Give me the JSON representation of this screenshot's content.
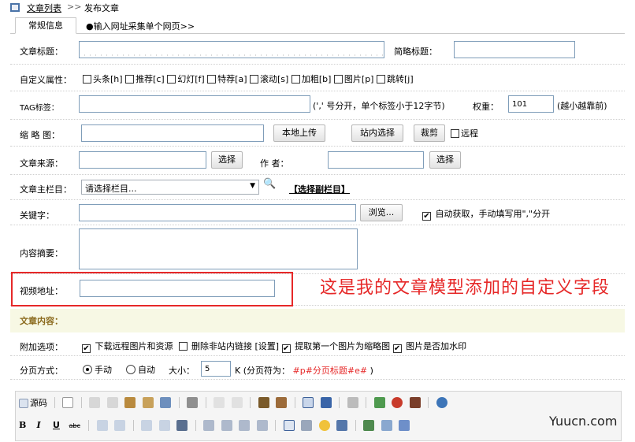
{
  "breadcrumb": {
    "list_link": "文章列表",
    "separator": ">>",
    "current": "发布文章"
  },
  "tabs": {
    "general": "常规信息",
    "url_collect": "●输入网址采集单个网页>>"
  },
  "form": {
    "title_label": "文章标题：",
    "short_title_label": "简略标题：",
    "custom_attr_label": "自定义属性：",
    "flags": [
      {
        "label": "头条[h]",
        "checked": false
      },
      {
        "label": "推荐[c]",
        "checked": false
      },
      {
        "label": "幻灯[f]",
        "checked": false
      },
      {
        "label": "特荐[a]",
        "checked": false
      },
      {
        "label": "滚动[s]",
        "checked": false
      },
      {
        "label": "加粗[b]",
        "checked": false
      },
      {
        "label": "图片[p]",
        "checked": false
      },
      {
        "label": "跳转[j]",
        "checked": false
      }
    ],
    "tag_label": "TAG标签：",
    "tag_hint": "(',' 号分开，单个标签小于12字节)",
    "weight_label": "权重：",
    "weight_value": "101",
    "weight_hint": "(越小越靠前)",
    "thumb_label": "缩 略 图：",
    "local_upload": "本地上传",
    "site_select": "站内选择",
    "crop": "裁剪",
    "remote_label": "远程",
    "source_label": "文章来源：",
    "select_btn": "选择",
    "author_label": "作 者：",
    "column_label": "文章主栏目：",
    "column_select": "请选择栏目...",
    "sub_column": "【选择副栏目】",
    "keywords_label": "关键字：",
    "browse": "浏览...",
    "auto_fetch": "自动获取，手动填写用\",\"分开",
    "summary_label": "内容摘要：",
    "video_label": "视频地址：",
    "annotation": "这是我的文章模型添加的自定义字段",
    "content_label": "文章内容：",
    "extra_label": "附加选项：",
    "extra_options": [
      {
        "label": "下载远程图片和资源",
        "checked": true
      },
      {
        "label": "删除非站内链接 [设置]",
        "checked": false
      },
      {
        "label": "提取第一个图片为缩略图",
        "checked": true
      },
      {
        "label": "图片是否加水印",
        "checked": true
      }
    ],
    "paging_label": "分页方式：",
    "paging_manual": "手动",
    "paging_auto": "自动",
    "size_label": "大小：",
    "size_value": "5",
    "size_hint_prefix": "K (分页符为：",
    "size_hint_marker": "#p#分页标题#e#",
    "size_hint_suffix": ")"
  },
  "editor": {
    "source_label": "源码",
    "row2": {
      "bold": "B",
      "italic": "I",
      "underline": "U",
      "strike": "abc"
    }
  },
  "watermark": "Yuucn.com",
  "colors": {
    "annotation": "#e62828",
    "highlight_box": "#e62828",
    "content_band": "#f7f8e4",
    "content_label": "#8b6a1d"
  }
}
